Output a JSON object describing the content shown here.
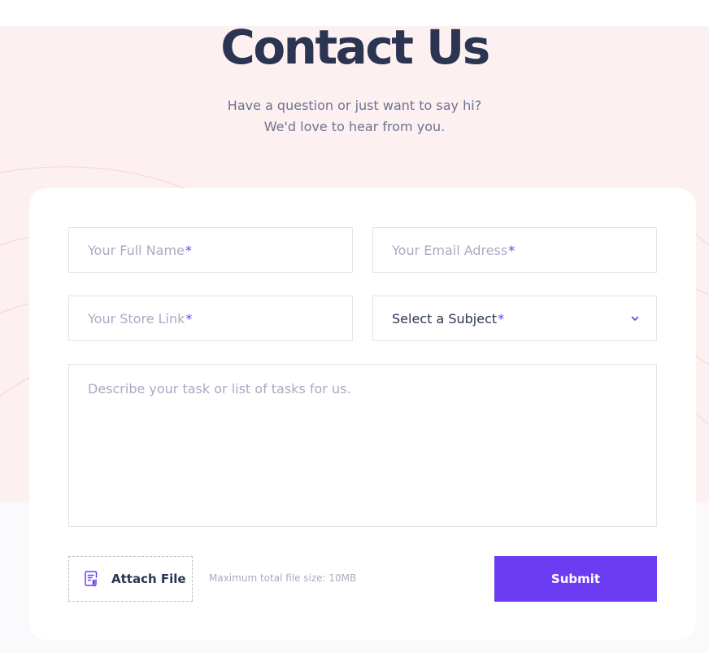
{
  "header": {
    "title": "Contact Us",
    "subtitle_line1": "Have a question or just want to say hi?",
    "subtitle_line2": "We'd love to hear from you."
  },
  "form": {
    "full_name_placeholder": "Your Full Name",
    "email_placeholder": "Your Email Adress",
    "store_link_placeholder": "Your Store Link",
    "subject_value": "Select a Subject",
    "required_marker": "*",
    "message_placeholder": "Describe your task or list of tasks for us.",
    "attach_label": "Attach File",
    "file_size_note": "Maximum total file size: 10MB",
    "submit_label": "Submit"
  },
  "colors": {
    "accent": "#6c3cf2",
    "heading": "#2b3552",
    "background_pink": "#fdf0f0"
  },
  "icons": {
    "attach": "file-attachment-icon",
    "dropdown": "chevron-down-icon"
  }
}
